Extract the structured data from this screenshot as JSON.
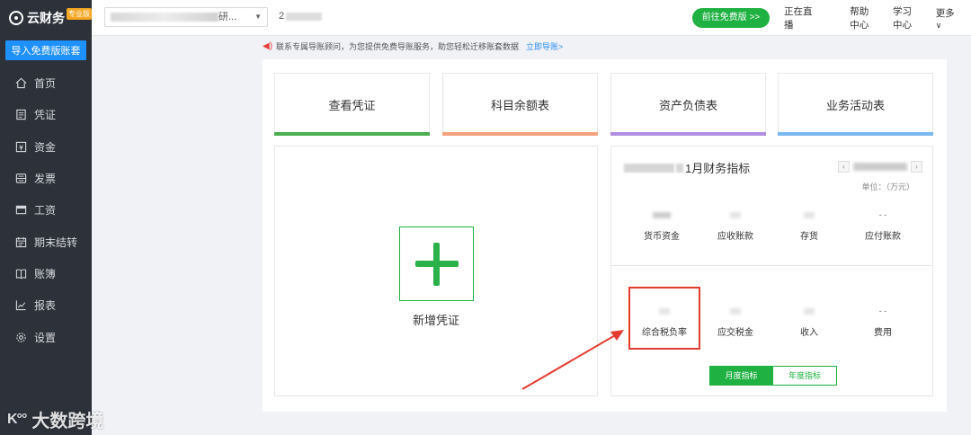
{
  "sidebar": {
    "logo_text": "云财务",
    "logo_badge": "专业版",
    "import_button": "导入免费版账套",
    "items": [
      {
        "label": "首页",
        "icon": "home-icon"
      },
      {
        "label": "凭证",
        "icon": "voucher-icon"
      },
      {
        "label": "资金",
        "icon": "fund-icon"
      },
      {
        "label": "发票",
        "icon": "invoice-icon"
      },
      {
        "label": "工资",
        "icon": "salary-icon"
      },
      {
        "label": "期末结转",
        "icon": "calendar-icon"
      },
      {
        "label": "账簿",
        "icon": "book-icon"
      },
      {
        "label": "报表",
        "icon": "chart-icon"
      },
      {
        "label": "设置",
        "icon": "gear-icon"
      }
    ]
  },
  "header": {
    "company_suffix": "研...",
    "period_prefix": "2",
    "free_button": "前往免费版 >>",
    "links": {
      "live": "正在直播",
      "help": "帮助中心",
      "learn": "学习中心",
      "more": "更多"
    }
  },
  "notice": {
    "text": "联系专属导账顾问，为您提供免费导账服务，助您轻松迁移账套数据",
    "link": "立即导账>"
  },
  "quick_cards": [
    {
      "label": "查看凭证",
      "color": "#4caf50"
    },
    {
      "label": "科目余额表",
      "color": "#f4a37e"
    },
    {
      "label": "资产负债表",
      "color": "#b18ee0"
    },
    {
      "label": "业务活动表",
      "color": "#7ab8f0"
    }
  ],
  "voucher": {
    "label": "新增凭证"
  },
  "finance": {
    "title_suffix": "1月财务指标",
    "unit": "单位：（万元）",
    "row1": [
      {
        "label": "货币资金",
        "value": ""
      },
      {
        "label": "应收账款",
        "value": ""
      },
      {
        "label": "存货",
        "value": ""
      },
      {
        "label": "应付账款",
        "value": "- -"
      }
    ],
    "row2": [
      {
        "label": "综合税负率",
        "value": ""
      },
      {
        "label": "应交税金",
        "value": ""
      },
      {
        "label": "收入",
        "value": ""
      },
      {
        "label": "费用",
        "value": "- -"
      }
    ],
    "tabs": {
      "monthly": "月度指标",
      "yearly": "年度指标"
    }
  },
  "watermark": "大数跨境",
  "colors": {
    "accent_green": "#1fb141",
    "sidebar_bg": "#2d3139",
    "highlight_red": "#e33b2f",
    "link_blue": "#2d8cf0"
  }
}
